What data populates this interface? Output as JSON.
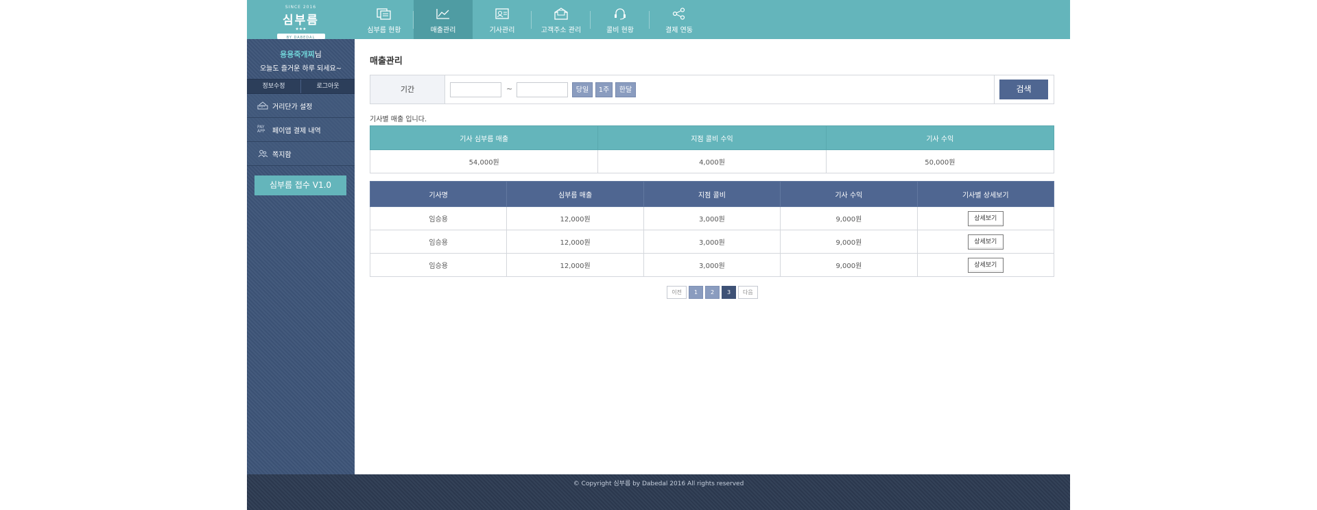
{
  "brand": {
    "since": "SINCE 2016",
    "name": "심부름",
    "stars": "★★★",
    "ribbon": "BY DABEDAL"
  },
  "nav": [
    {
      "label": "심부름 현황",
      "icon": "document-list-icon"
    },
    {
      "label": "매출관리",
      "icon": "line-chart-icon"
    },
    {
      "label": "기사관리",
      "icon": "id-card-icon"
    },
    {
      "label": "고객주소 관리",
      "icon": "mail-open-icon"
    },
    {
      "label": "콜비 현황",
      "icon": "headset-icon"
    },
    {
      "label": "결제 연동",
      "icon": "share-icon"
    }
  ],
  "sidebar": {
    "user_name": "용용죽개찌",
    "user_suffix": "님",
    "greeting": "오늘도 즐거운 하루 되세요~",
    "edit_info": "정보수정",
    "logout": "로그아웃",
    "menu": [
      {
        "label": "거리단가 설정",
        "icon": "ruler-icon"
      },
      {
        "label": "페이앱 결제 내역",
        "icon": "payapp-icon"
      },
      {
        "label": "쪽지함",
        "icon": "people-icon"
      }
    ],
    "version_button": "심부름 접수 V1.0"
  },
  "main": {
    "title": "매출관리",
    "search": {
      "label": "기간",
      "tilde": "~",
      "today": "당일",
      "week": "1주",
      "month": "한달",
      "submit": "검색"
    },
    "description": "기사별 매출 입니다.",
    "summary": {
      "headers": [
        "기사 심부름 매출",
        "지점 콜비 수익",
        "기사 수익"
      ],
      "values": [
        "54,000원",
        "4,000원",
        "50,000원"
      ]
    },
    "detail": {
      "headers": [
        "기사명",
        "심부름 매출",
        "지점 콜비",
        "기사 수익",
        "기사별 상세보기"
      ],
      "rows": [
        {
          "name": "임승용",
          "sales": "12,000원",
          "call_fee": "3,000원",
          "profit": "9,000원",
          "action": "상세보기"
        },
        {
          "name": "임승용",
          "sales": "12,000원",
          "call_fee": "3,000원",
          "profit": "9,000원",
          "action": "상세보기"
        },
        {
          "name": "임승용",
          "sales": "12,000원",
          "call_fee": "3,000원",
          "profit": "9,000원",
          "action": "상세보기"
        }
      ]
    },
    "pagination": {
      "prev": "이전",
      "pages": [
        "1",
        "2",
        "3"
      ],
      "current": "3",
      "next": "다음"
    }
  },
  "footer": {
    "copyright": "© Copyright 심부름 by Dabedal 2016 All rights reserved"
  },
  "colors": {
    "teal": "#64b5bb",
    "navy": "#4f6691",
    "sidebar": "#3d5478"
  }
}
